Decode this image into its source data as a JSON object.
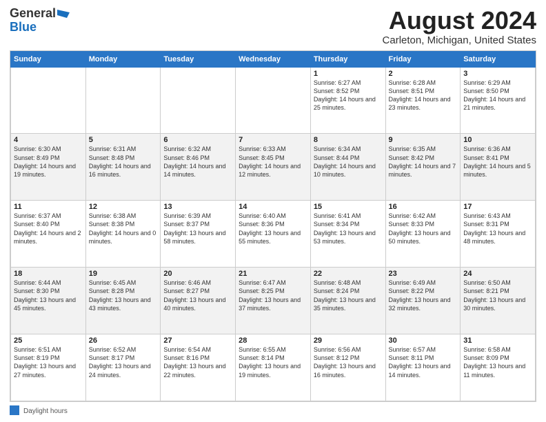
{
  "logo": {
    "general": "General",
    "blue": "Blue"
  },
  "title": "August 2024",
  "subtitle": "Carleton, Michigan, United States",
  "days_of_week": [
    "Sunday",
    "Monday",
    "Tuesday",
    "Wednesday",
    "Thursday",
    "Friday",
    "Saturday"
  ],
  "weeks": [
    [
      {
        "day": "",
        "info": ""
      },
      {
        "day": "",
        "info": ""
      },
      {
        "day": "",
        "info": ""
      },
      {
        "day": "",
        "info": ""
      },
      {
        "day": "1",
        "info": "Sunrise: 6:27 AM\nSunset: 8:52 PM\nDaylight: 14 hours and 25 minutes."
      },
      {
        "day": "2",
        "info": "Sunrise: 6:28 AM\nSunset: 8:51 PM\nDaylight: 14 hours and 23 minutes."
      },
      {
        "day": "3",
        "info": "Sunrise: 6:29 AM\nSunset: 8:50 PM\nDaylight: 14 hours and 21 minutes."
      }
    ],
    [
      {
        "day": "4",
        "info": "Sunrise: 6:30 AM\nSunset: 8:49 PM\nDaylight: 14 hours and 19 minutes."
      },
      {
        "day": "5",
        "info": "Sunrise: 6:31 AM\nSunset: 8:48 PM\nDaylight: 14 hours and 16 minutes."
      },
      {
        "day": "6",
        "info": "Sunrise: 6:32 AM\nSunset: 8:46 PM\nDaylight: 14 hours and 14 minutes."
      },
      {
        "day": "7",
        "info": "Sunrise: 6:33 AM\nSunset: 8:45 PM\nDaylight: 14 hours and 12 minutes."
      },
      {
        "day": "8",
        "info": "Sunrise: 6:34 AM\nSunset: 8:44 PM\nDaylight: 14 hours and 10 minutes."
      },
      {
        "day": "9",
        "info": "Sunrise: 6:35 AM\nSunset: 8:42 PM\nDaylight: 14 hours and 7 minutes."
      },
      {
        "day": "10",
        "info": "Sunrise: 6:36 AM\nSunset: 8:41 PM\nDaylight: 14 hours and 5 minutes."
      }
    ],
    [
      {
        "day": "11",
        "info": "Sunrise: 6:37 AM\nSunset: 8:40 PM\nDaylight: 14 hours and 2 minutes."
      },
      {
        "day": "12",
        "info": "Sunrise: 6:38 AM\nSunset: 8:38 PM\nDaylight: 14 hours and 0 minutes."
      },
      {
        "day": "13",
        "info": "Sunrise: 6:39 AM\nSunset: 8:37 PM\nDaylight: 13 hours and 58 minutes."
      },
      {
        "day": "14",
        "info": "Sunrise: 6:40 AM\nSunset: 8:36 PM\nDaylight: 13 hours and 55 minutes."
      },
      {
        "day": "15",
        "info": "Sunrise: 6:41 AM\nSunset: 8:34 PM\nDaylight: 13 hours and 53 minutes."
      },
      {
        "day": "16",
        "info": "Sunrise: 6:42 AM\nSunset: 8:33 PM\nDaylight: 13 hours and 50 minutes."
      },
      {
        "day": "17",
        "info": "Sunrise: 6:43 AM\nSunset: 8:31 PM\nDaylight: 13 hours and 48 minutes."
      }
    ],
    [
      {
        "day": "18",
        "info": "Sunrise: 6:44 AM\nSunset: 8:30 PM\nDaylight: 13 hours and 45 minutes."
      },
      {
        "day": "19",
        "info": "Sunrise: 6:45 AM\nSunset: 8:28 PM\nDaylight: 13 hours and 43 minutes."
      },
      {
        "day": "20",
        "info": "Sunrise: 6:46 AM\nSunset: 8:27 PM\nDaylight: 13 hours and 40 minutes."
      },
      {
        "day": "21",
        "info": "Sunrise: 6:47 AM\nSunset: 8:25 PM\nDaylight: 13 hours and 37 minutes."
      },
      {
        "day": "22",
        "info": "Sunrise: 6:48 AM\nSunset: 8:24 PM\nDaylight: 13 hours and 35 minutes."
      },
      {
        "day": "23",
        "info": "Sunrise: 6:49 AM\nSunset: 8:22 PM\nDaylight: 13 hours and 32 minutes."
      },
      {
        "day": "24",
        "info": "Sunrise: 6:50 AM\nSunset: 8:21 PM\nDaylight: 13 hours and 30 minutes."
      }
    ],
    [
      {
        "day": "25",
        "info": "Sunrise: 6:51 AM\nSunset: 8:19 PM\nDaylight: 13 hours and 27 minutes."
      },
      {
        "day": "26",
        "info": "Sunrise: 6:52 AM\nSunset: 8:17 PM\nDaylight: 13 hours and 24 minutes."
      },
      {
        "day": "27",
        "info": "Sunrise: 6:54 AM\nSunset: 8:16 PM\nDaylight: 13 hours and 22 minutes."
      },
      {
        "day": "28",
        "info": "Sunrise: 6:55 AM\nSunset: 8:14 PM\nDaylight: 13 hours and 19 minutes."
      },
      {
        "day": "29",
        "info": "Sunrise: 6:56 AM\nSunset: 8:12 PM\nDaylight: 13 hours and 16 minutes."
      },
      {
        "day": "30",
        "info": "Sunrise: 6:57 AM\nSunset: 8:11 PM\nDaylight: 13 hours and 14 minutes."
      },
      {
        "day": "31",
        "info": "Sunrise: 6:58 AM\nSunset: 8:09 PM\nDaylight: 13 hours and 11 minutes."
      }
    ]
  ],
  "footer": {
    "legend_label": "Daylight hours"
  }
}
